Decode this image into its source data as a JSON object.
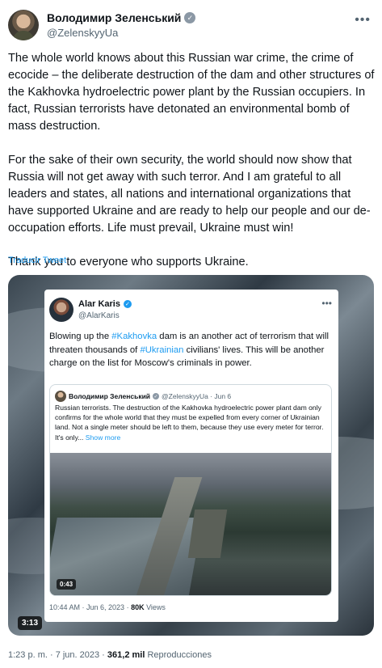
{
  "author": {
    "name": "Володимир Зеленський",
    "handle": "@ZelenskyyUa"
  },
  "tweet": {
    "paragraphs": [
      "The whole world knows about this Russian war crime, the crime of ecocide – the deliberate destruction of the dam and other structures of the Kakhovka hydroelectric power plant by the Russian occupiers. In fact, Russian terrorists have detonated an environmental bomb of mass destruction.",
      "For the sake of their own security, the world should now show that Russia will not get away with such terror. And I am grateful to all leaders and states, all nations and international organizations that have supported Ukraine and are ready to help our people and our de-occupation efforts. Life must prevail, Ukraine must win!",
      "Thank you to everyone who supports Ukraine."
    ],
    "translate_label": "Traducir Tweet"
  },
  "media": {
    "duration": "3:13",
    "embedded_tweet": {
      "name": "Alar Karis",
      "handle": "@AlarKaris",
      "text_parts": [
        "Blowing up the ",
        "#Kakhovka",
        " dam is an another act of terrorism that will threaten thousands of ",
        "#Ukrainian",
        " civilians' lives. This will be another charge on the list for Moscow's criminals in power."
      ],
      "quote": {
        "name": "Володимир Зеленський",
        "handle_date": "@ZelenskyyUa · Jun 6",
        "text": "Russian terrorists. The destruction of the Kakhovka hydroelectric power plant dam only confirms for the whole world that they must be expelled from every corner of Ukrainian land. Not a single meter should be left to them, because they use every meter for terror. It's only...",
        "show_more": "Show more",
        "video_time": "0:43"
      },
      "timestamp": "10:44 AM · Jun 6, 2023 · ",
      "views_count": "80K",
      "views_label": " Views"
    }
  },
  "footer": {
    "time_date": "1:23 p. m. · 7 jun. 2023 · ",
    "views_count": "361,2 mil",
    "views_label": " Reproducciones"
  },
  "colors": {
    "link": "#1d9bf0",
    "secondary_text": "#536471",
    "primary_text": "#0f1419"
  }
}
